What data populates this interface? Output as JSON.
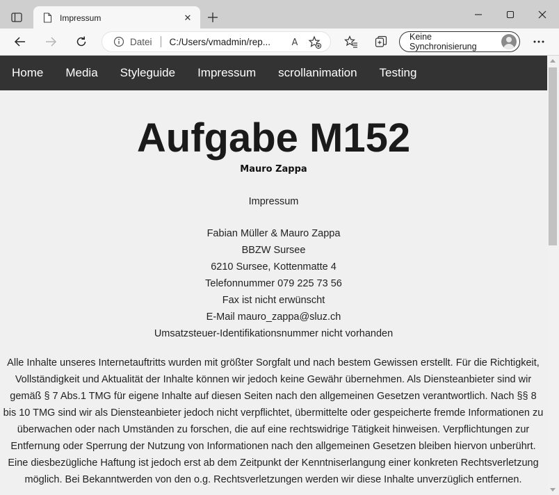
{
  "browser": {
    "tab": {
      "title": "Impressum",
      "close_label": "✕"
    },
    "address": {
      "scheme_label": "Datei",
      "url": "C:/Users/vmadmin/rep..."
    },
    "sync_label": "Keine Synchronisierung",
    "read_aloud_label": "A"
  },
  "site": {
    "nav": [
      "Home",
      "Media",
      "Styleguide",
      "Impressum",
      "scrollanimation",
      "Testing"
    ],
    "title": "Aufgabe M152",
    "author": "Mauro Zappa",
    "section_heading": "Impressum",
    "contact": [
      "Fabian Müller & Mauro Zappa",
      "BBZW Sursee",
      "6210 Sursee, Kottenmatte 4",
      "Telefonnummer 079 225 73 56",
      "Fax ist nicht erwünscht",
      "E-Mail mauro_zappa@sluz.ch",
      "Umsatzsteuer-Identifikationsnummer nicht vorhanden"
    ],
    "disclaimer": "Alle Inhalte unseres Internetauftritts wurden mit größter Sorgfalt und nach bestem Gewissen erstellt. Für die Richtigkeit, Vollständigkeit und Aktualität der Inhalte können wir jedoch keine Gewähr übernehmen. Als Diensteanbieter sind wir gemäß § 7 Abs.1 TMG für eigene Inhalte auf diesen Seiten nach den allgemeinen Gesetzen verantwortlich. Nach §§ 8 bis 10 TMG sind wir als Diensteanbieter jedoch nicht verpflichtet, übermittelte oder gespeicherte fremde Informationen zu überwachen oder nach Umständen zu forschen, die auf eine rechtswidrige Tätigkeit hinweisen. Verpflichtungen zur Entfernung oder Sperrung der Nutzung von Informationen nach den allgemeinen Gesetzen bleiben hiervon unberührt. Eine diesbezügliche Haftung ist jedoch erst ab dem Zeitpunkt der Kenntniserlangung einer konkreten Rechtsverletzung möglich. Bei Bekanntwerden von den o.g. Rechtsverletzungen werden wir diese Inhalte unverzüglich entfernen."
  },
  "colors": {
    "nav_background": "#333333",
    "page_background": "#f0f0f0",
    "browser_frame": "#cfcfcf"
  }
}
